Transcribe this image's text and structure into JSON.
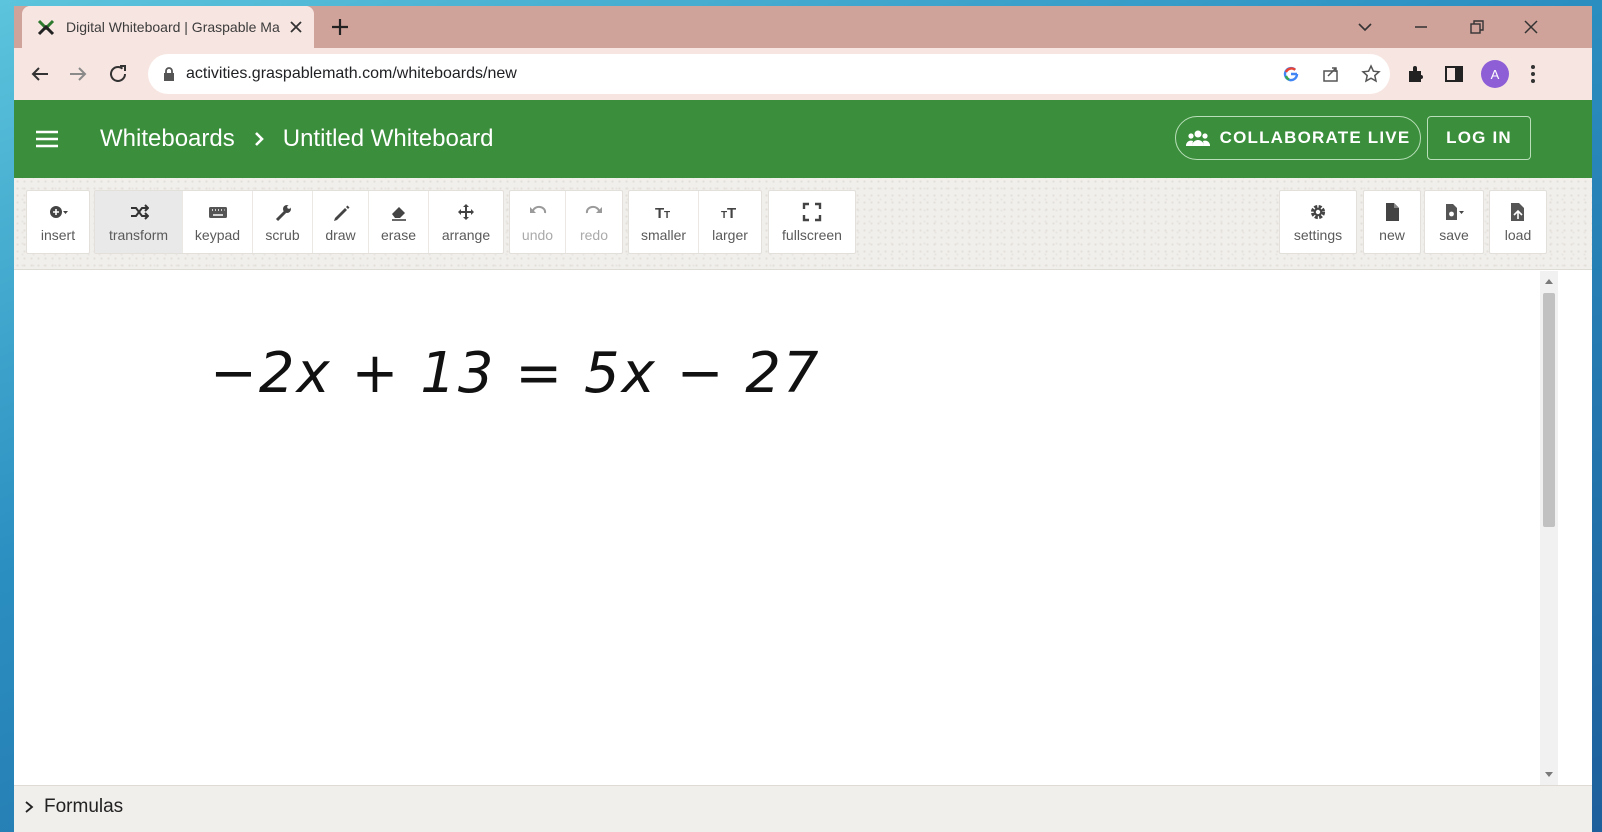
{
  "browser": {
    "tab_title": "Digital Whiteboard | Graspable Math",
    "url": "activities.graspablemath.com/whiteboards/new",
    "profile_initial": "A"
  },
  "header": {
    "crumb_root": "Whiteboards",
    "crumb_current": "Untitled Whiteboard",
    "collaborate_label": "COLLABORATE LIVE",
    "login_label": "LOG IN"
  },
  "toolbar": {
    "left_groups": [
      [
        {
          "id": "insert",
          "label": "insert",
          "icon": "plus-circle-dropdown-icon"
        }
      ],
      [
        {
          "id": "transform",
          "label": "transform",
          "icon": "shuffle-icon",
          "active": true
        },
        {
          "id": "keypad",
          "label": "keypad",
          "icon": "keyboard-icon"
        },
        {
          "id": "scrub",
          "label": "scrub",
          "icon": "wrench-icon"
        },
        {
          "id": "draw",
          "label": "draw",
          "icon": "pencil-icon"
        },
        {
          "id": "erase",
          "label": "erase",
          "icon": "eraser-icon"
        },
        {
          "id": "arrange",
          "label": "arrange",
          "icon": "move-arrows-icon"
        }
      ],
      [
        {
          "id": "undo",
          "label": "undo",
          "icon": "undo-icon",
          "disabled": true
        },
        {
          "id": "redo",
          "label": "redo",
          "icon": "redo-icon",
          "disabled": true
        }
      ],
      [
        {
          "id": "smaller",
          "label": "smaller",
          "icon": "text-smaller-icon"
        },
        {
          "id": "larger",
          "label": "larger",
          "icon": "text-larger-icon"
        }
      ],
      [
        {
          "id": "fullscreen",
          "label": "fullscreen",
          "icon": "expand-icon"
        }
      ]
    ],
    "right_groups": [
      [
        {
          "id": "settings",
          "label": "settings",
          "icon": "gear-icon"
        }
      ],
      [
        {
          "id": "new",
          "label": "new",
          "icon": "file-icon"
        }
      ],
      [
        {
          "id": "save",
          "label": "save",
          "icon": "save-file-dropdown-icon"
        }
      ],
      [
        {
          "id": "load",
          "label": "load",
          "icon": "load-file-icon"
        }
      ]
    ]
  },
  "canvas": {
    "equation": "−2x + 13 = 5x − 27"
  },
  "footer": {
    "formulas_label": "Formulas"
  },
  "colors": {
    "app_header": "#3b8f3c",
    "tabstrip": "#cfa29a",
    "tab_active": "#f7e5e1",
    "avatar": "#8e5ed6"
  }
}
